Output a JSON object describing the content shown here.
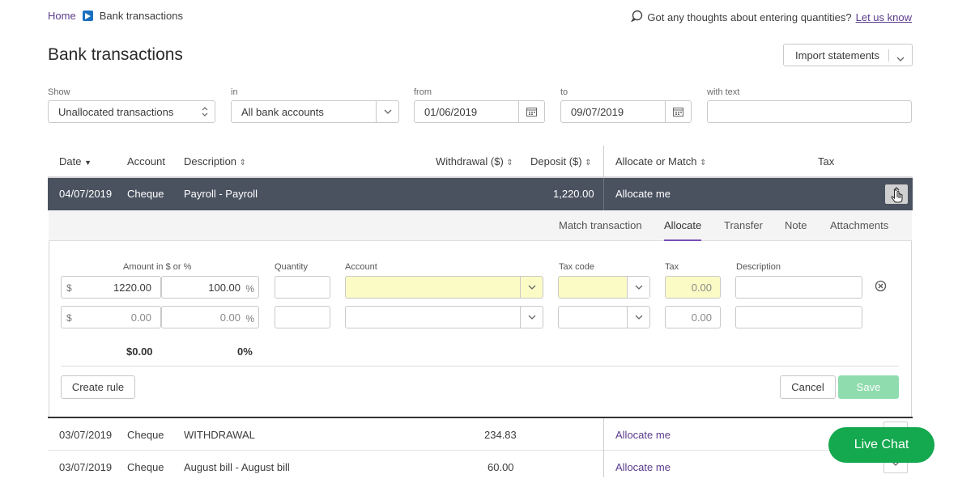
{
  "breadcrumb": {
    "home": "Home",
    "current": "Bank transactions"
  },
  "feedback": {
    "question": "Got any thoughts about entering quantities?",
    "link": "Let us know"
  },
  "page": {
    "title": "Bank transactions",
    "import_button": "Import statements"
  },
  "filters": {
    "show_label": "Show",
    "show_value": "Unallocated transactions",
    "in_label": "in",
    "in_value": "All bank accounts",
    "from_label": "from",
    "from_value": "01/06/2019",
    "to_label": "to",
    "to_value": "09/07/2019",
    "text_label": "with text",
    "text_value": ""
  },
  "table": {
    "headers": {
      "date": "Date",
      "account": "Account",
      "description": "Description",
      "withdrawal": "Withdrawal ($)",
      "deposit": "Deposit ($)",
      "allocate": "Allocate or Match",
      "tax": "Tax"
    },
    "selected": {
      "date": "04/07/2019",
      "account": "Cheque",
      "description": "Payroll - Payroll",
      "withdrawal": "",
      "deposit": "1,220.00",
      "allocate": "Allocate me"
    },
    "rows": [
      {
        "date": "03/07/2019",
        "account": "Cheque",
        "description": "WITHDRAWAL",
        "withdrawal": "234.83",
        "deposit": "",
        "allocate": "Allocate me"
      },
      {
        "date": "03/07/2019",
        "account": "Cheque",
        "description": "August bill - August bill",
        "withdrawal": "60.00",
        "deposit": "",
        "allocate": "Allocate me"
      }
    ]
  },
  "detail": {
    "tabs": [
      "Match transaction",
      "Allocate",
      "Transfer",
      "Note",
      "Attachments"
    ],
    "active_tab": "Allocate",
    "columns": {
      "amount": "Amount in $ or %",
      "quantity": "Quantity",
      "account": "Account",
      "taxcode": "Tax code",
      "tax": "Tax",
      "description": "Description"
    },
    "lines": [
      {
        "currency": "$",
        "amount": "1220.00",
        "percent": "100.00",
        "pct_sym": "%",
        "tax": "0.00"
      },
      {
        "currency": "$",
        "amount": "0.00",
        "percent": "0.00",
        "pct_sym": "%",
        "tax": "0.00"
      }
    ],
    "totals": {
      "amount": "$0.00",
      "percent": "0%"
    },
    "create_rule": "Create rule",
    "cancel": "Cancel",
    "save": "Save"
  },
  "live_chat": "Live Chat",
  "colors": {
    "accent": "#5a3b8c",
    "selected_row": "#4a5260",
    "save": "#8fdcae",
    "livechat": "#14a84f",
    "highlight": "#fbfbc6"
  }
}
